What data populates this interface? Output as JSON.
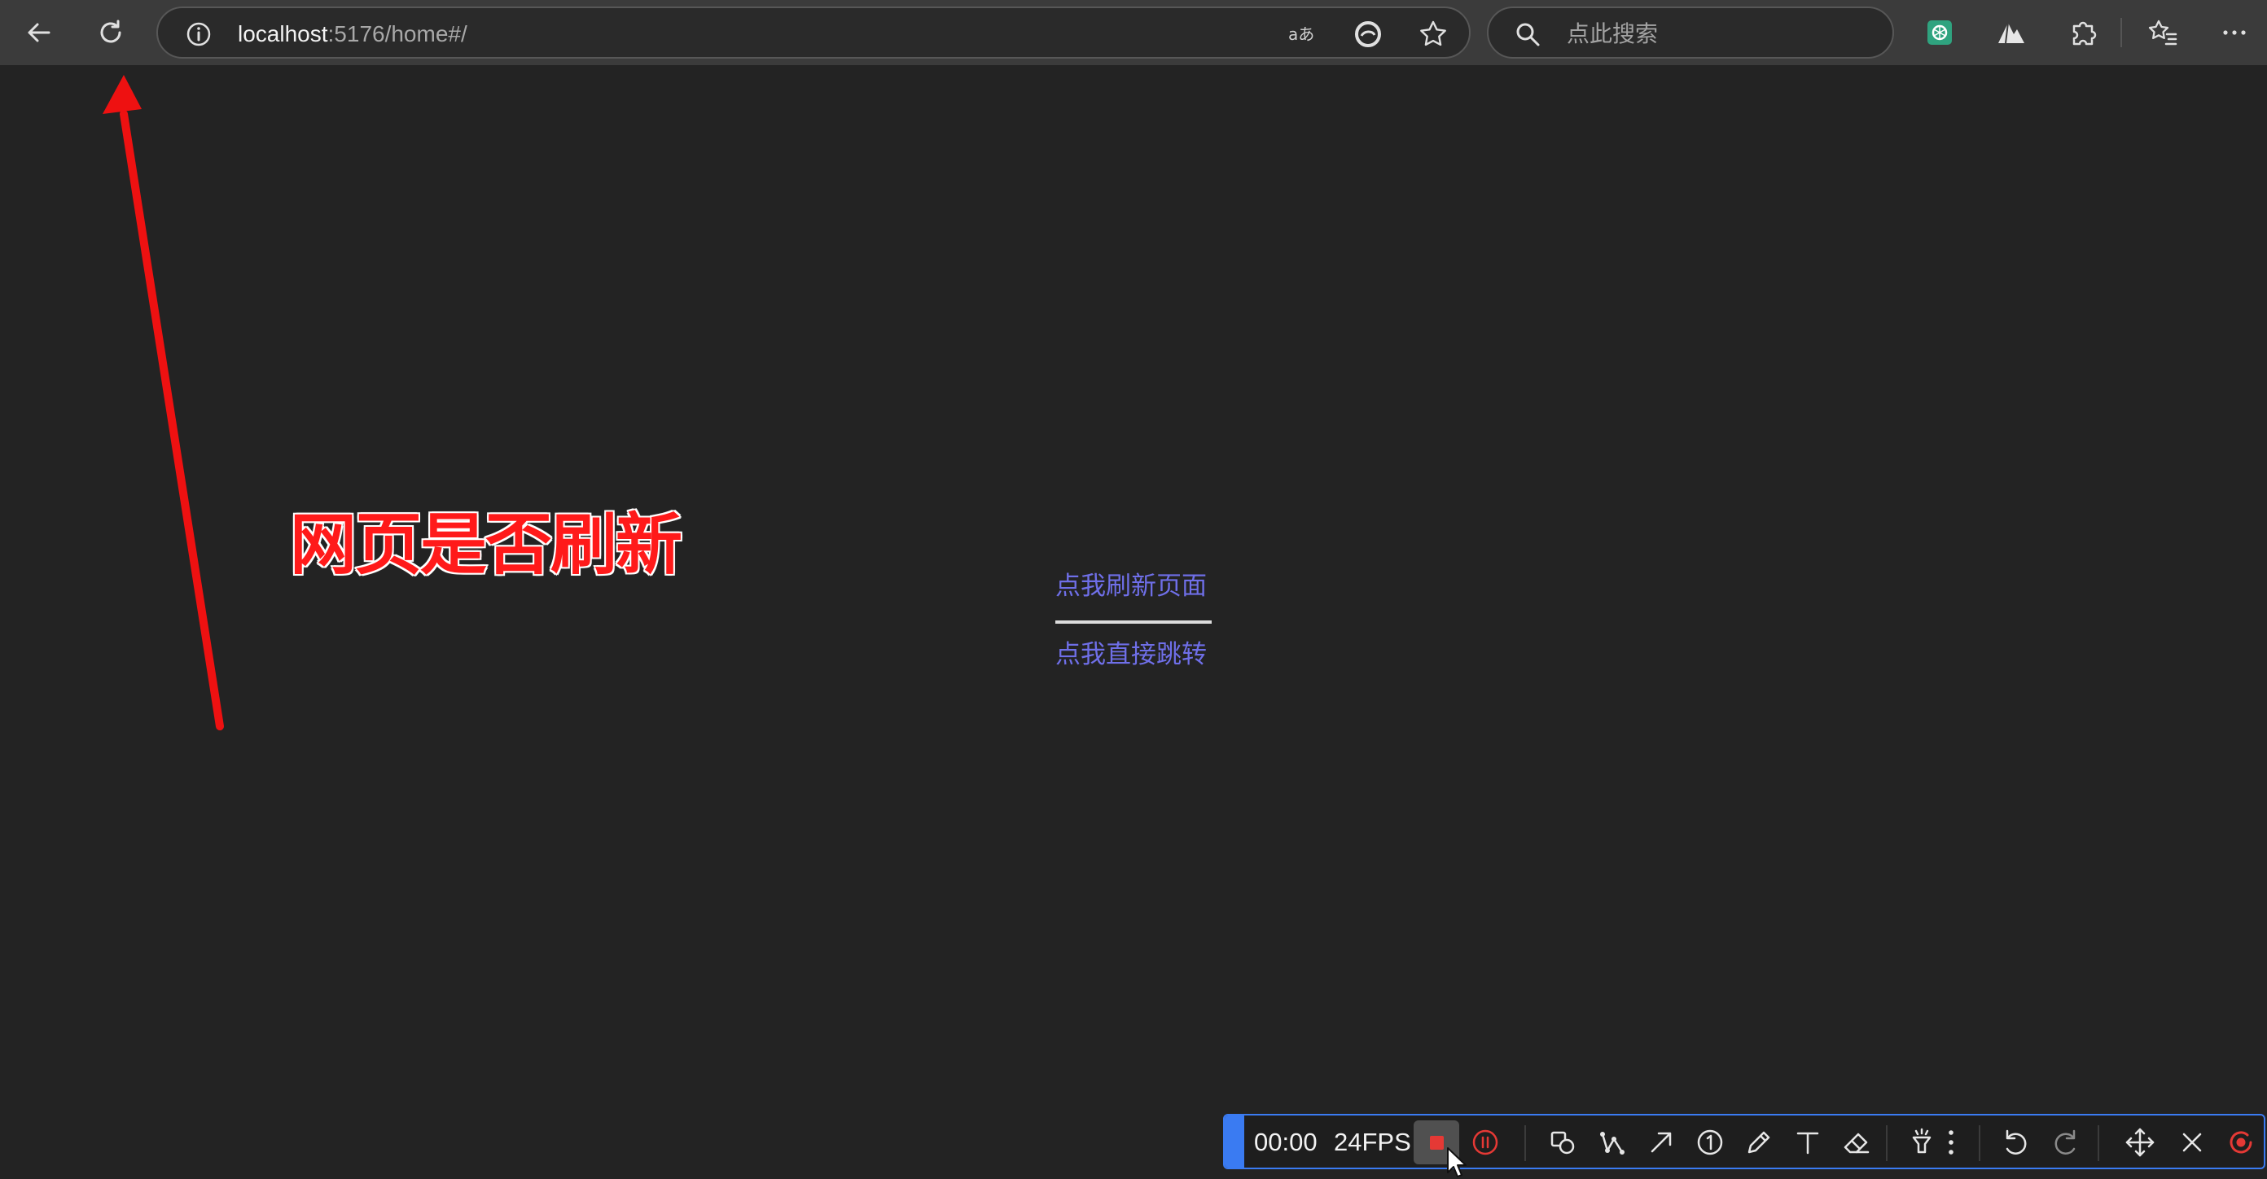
{
  "browser": {
    "url_host": "localhost",
    "url_path": ":5176/home#/",
    "search_placeholder": "点此搜索",
    "icons": [
      "back-arrow-icon",
      "refresh-icon",
      "info-icon",
      "read-aloud-icon",
      "edge-sidebar-icon",
      "favorite-star-icon",
      "search-icon",
      "chatgpt-extension-icon",
      "extension-mountain-icon",
      "extensions-puzzle-icon",
      "favorites-list-icon",
      "more-menu-icon"
    ]
  },
  "page": {
    "links": {
      "refresh_label": "点我刷新页面",
      "jump_label": "点我直接跳转"
    },
    "link_color": "#6f6fe8"
  },
  "annotation": {
    "text": "网页是否刷新",
    "color": "#ff1a1a"
  },
  "recorder": {
    "time": "00:00",
    "fps": "24FPS",
    "accent_color": "#3a7bf2",
    "stop_color": "#e53935",
    "tools": [
      "stop-icon",
      "pause-icon",
      "shape-icon",
      "polyline-icon",
      "arrow-icon",
      "number-marker-icon",
      "pen-icon",
      "text-icon",
      "eraser-icon",
      "spotlight-icon",
      "more-vertical-icon",
      "undo-icon",
      "redo-icon",
      "move-icon",
      "close-icon",
      "record-icon"
    ]
  }
}
